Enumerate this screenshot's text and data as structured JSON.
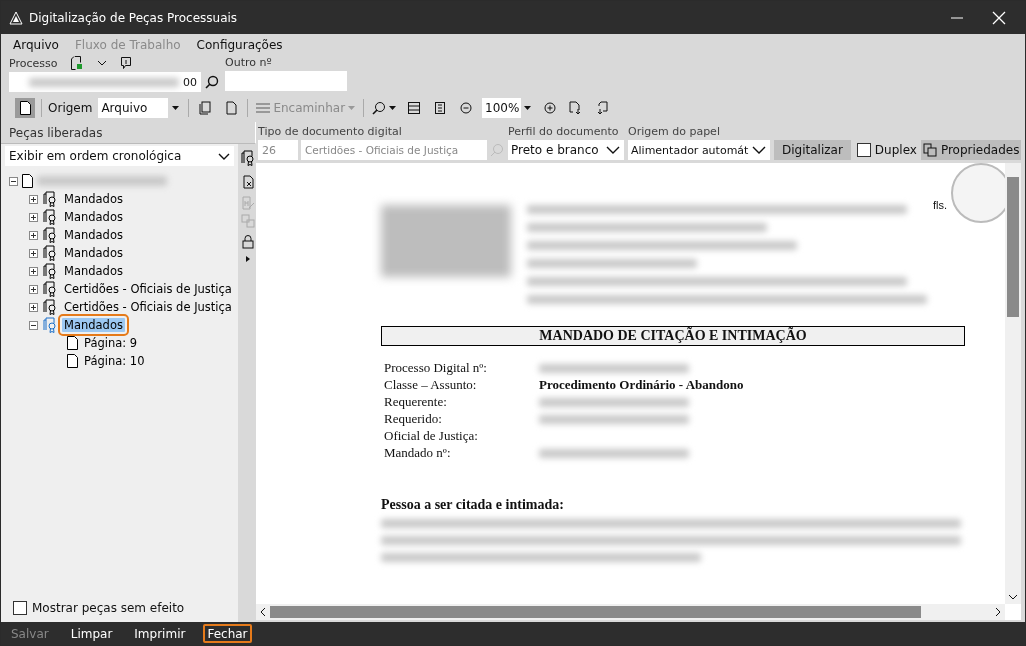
{
  "window": {
    "title": "Digitalização de Peças Processuais"
  },
  "menu": [
    {
      "label": "Arquivo",
      "disabled": false
    },
    {
      "label": "Fluxo de Trabalho",
      "disabled": true
    },
    {
      "label": "Configurações",
      "disabled": false
    }
  ],
  "process": {
    "label": "Processo",
    "value": "00",
    "other_label": "Outro nº"
  },
  "toolbar": {
    "origin_label": "Origem",
    "origin_value": "Arquivo",
    "forward": {
      "label": "Encaminhar",
      "disabled": true
    },
    "zoom": "100%"
  },
  "left_panel": {
    "title": "Peças liberadas",
    "order": "Exibir em ordem cronológica",
    "show_void": {
      "label": "Mostrar peças sem efeito",
      "checked": false
    },
    "tree": {
      "expanded": true,
      "children": [
        {
          "label": "Mandados",
          "expanded": false,
          "selected": false,
          "highlighted": false
        },
        {
          "label": "Mandados",
          "expanded": false,
          "selected": false,
          "highlighted": false
        },
        {
          "label": "Mandados",
          "expanded": false,
          "selected": false,
          "highlighted": false
        },
        {
          "label": "Mandados",
          "expanded": false,
          "selected": false,
          "highlighted": false
        },
        {
          "label": "Mandados",
          "expanded": false,
          "selected": false,
          "highlighted": false
        },
        {
          "label": "Certidões - Oficiais de Justiça",
          "expanded": false,
          "selected": false,
          "highlighted": false
        },
        {
          "label": "Certidões - Oficiais de Justiça",
          "expanded": false,
          "selected": false,
          "highlighted": false
        },
        {
          "label": "Mandados",
          "expanded": true,
          "selected": true,
          "highlighted": true,
          "children": [
            {
              "label": "Página: 9"
            },
            {
              "label": "Página: 10"
            }
          ]
        }
      ]
    }
  },
  "scan": {
    "doc_type_label": "Tipo de documento digital",
    "doc_type_code": "26",
    "doc_type_name": "Certidões - Oficiais de Justiça",
    "profile_label": "Perfil do documento",
    "profile": "Preto e branco",
    "paper_label": "Origem do papel",
    "paper": "Alimentador automát",
    "scan_button": "Digitalizar",
    "duplex": {
      "label": "Duplex",
      "checked": false
    },
    "properties_button": "Propriedades"
  },
  "document": {
    "page_mark": "fls.",
    "title": "MANDADO DE CITAÇÃO E INTIMAÇÃO",
    "fields": [
      {
        "label": "Processo Digital nº:",
        "blurred": true
      },
      {
        "label": "Classe – Assunto:",
        "value": "Procedimento Ordinário - Abandono"
      },
      {
        "label": "Requerente:",
        "blurred": true
      },
      {
        "label": "Requerido:",
        "blurred": true
      },
      {
        "label": "Oficial de Justiça:",
        "blurred": false
      },
      {
        "label": "Mandado nº:",
        "blurred": true
      }
    ],
    "section": "Pessoa a ser citada e intimada:"
  },
  "footer": [
    {
      "label": "Salvar",
      "disabled": true,
      "highlighted": false
    },
    {
      "label": "Limpar",
      "disabled": false,
      "highlighted": false
    },
    {
      "label": "Imprimir",
      "disabled": false,
      "highlighted": false
    },
    {
      "label": "Fechar",
      "disabled": false,
      "highlighted": true
    }
  ]
}
